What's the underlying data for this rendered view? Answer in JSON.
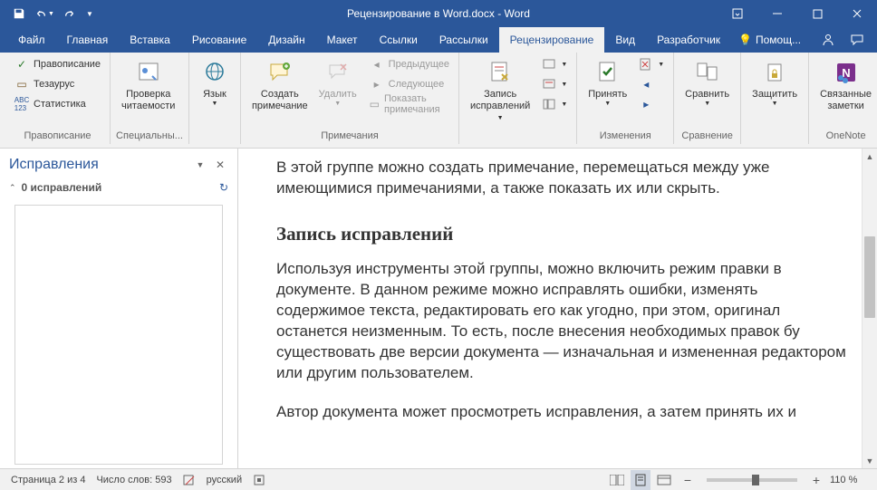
{
  "title": "Рецензирование в Word.docx - Word",
  "tabs": [
    "Файл",
    "Главная",
    "Вставка",
    "Рисование",
    "Дизайн",
    "Макет",
    "Ссылки",
    "Рассылки",
    "Рецензирование",
    "Вид",
    "Разработчик"
  ],
  "active_tab_index": 8,
  "help_label": "Помощ...",
  "ribbon": {
    "g1": {
      "label": "Правописание",
      "spelling": "Правописание",
      "thesaurus": "Тезаурус",
      "statistics": "Статистика"
    },
    "g2": {
      "label": "Специальны...",
      "btn1_l1": "Проверка",
      "btn1_l2": "читаемости"
    },
    "g3": {
      "label": "",
      "btn": "Язык"
    },
    "g4": {
      "label": "Примечания",
      "create_l1": "Создать",
      "create_l2": "примечание",
      "delete": "Удалить",
      "prev": "Предыдущее",
      "next": "Следующее",
      "show": "Показать примечания"
    },
    "g5": {
      "label": "",
      "track_l1": "Запись",
      "track_l2": "исправлений"
    },
    "g6": {
      "label": "Изменения",
      "accept": "Принять"
    },
    "g7": {
      "label": "Сравнение",
      "compare": "Сравнить"
    },
    "g8": {
      "label": "",
      "protect": "Защитить"
    },
    "g9": {
      "label": "OneNote",
      "linked_l1": "Связанные",
      "linked_l2": "заметки"
    }
  },
  "pane": {
    "title": "Исправления",
    "count_label": "0 исправлений"
  },
  "document": {
    "p1": "В этой группе можно создать примечание, перемещаться между уже имеющимися примечаниями, а также показать их или скрыть.",
    "h1": "Запись исправлений",
    "p2": "Используя инструменты этой группы, можно включить режим правки в документе. В данном режиме можно исправлять ошибки, изменять содержимое текста, редактировать его как угодно, при этом, оригинал останется неизменным. То есть, после внесения необходимых правок бу существовать две версии документа — изначальная и измененная редактором или другим пользователем.",
    "p3": "Автор документа может просмотреть исправления, а затем принять их и"
  },
  "statusbar": {
    "page": "Страница 2 из 4",
    "words": "Число слов: 593",
    "language": "русский",
    "zoom": "110 %"
  }
}
